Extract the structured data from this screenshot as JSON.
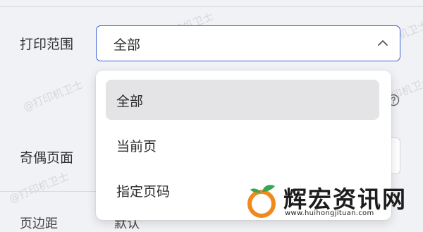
{
  "form": {
    "print_range_label": "打印范围",
    "odd_even_label": "奇偶页面",
    "print_range_select": {
      "value": "全部",
      "chevron": "chevron-up-icon"
    },
    "bottom_row_left": "页边距",
    "bottom_row_right": "默认"
  },
  "dropdown": {
    "options": [
      {
        "label": "全部",
        "selected": true
      },
      {
        "label": "当前页"
      },
      {
        "label": "指定页码"
      }
    ]
  },
  "watermark": "@打印机卫士",
  "brand": {
    "name": "辉宏资讯网",
    "url": "www.huihongjituan.com",
    "logo_icon": "orange-fruit-logo"
  },
  "colors": {
    "accent": "#3d63d6",
    "selected_bg": "#e4e4e6",
    "logo_orange": "#f08a1d",
    "logo_leaf": "#3aa655"
  }
}
